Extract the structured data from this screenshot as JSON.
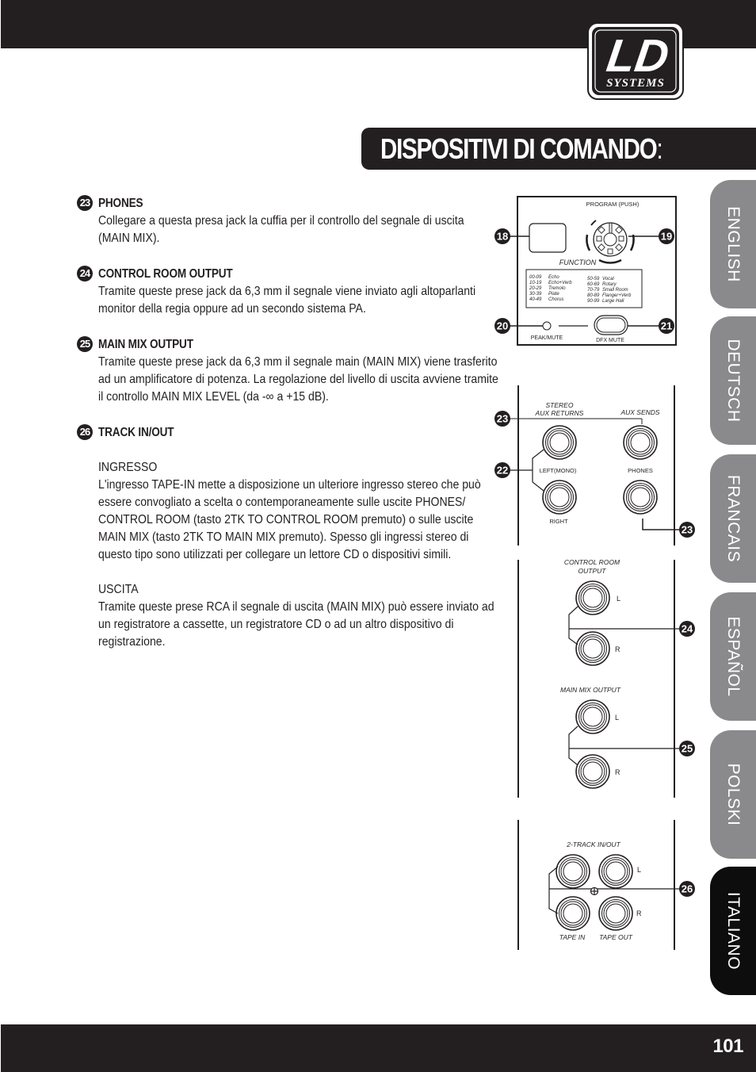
{
  "header": {
    "logo": {
      "brand": "LD",
      "sub": "SYSTEMS"
    }
  },
  "title": {
    "main": "DISPOSITIVI DI COMANDO",
    "suffix": ":"
  },
  "language_tabs": [
    {
      "label": "ENGLISH",
      "active": false
    },
    {
      "label": "DEUTSCH",
      "active": false
    },
    {
      "label": "FRANCAIS",
      "active": false
    },
    {
      "label": "ESPAÑOL",
      "active": false
    },
    {
      "label": "POLSKI",
      "active": false
    },
    {
      "label": "ITALIANO",
      "active": true
    }
  ],
  "sections": [
    {
      "number": "23",
      "title": "PHONES",
      "lines": [
        "Collegare a questa presa jack la cuffia per il controllo del segnale di uscita",
        "(MAIN MIX)."
      ]
    },
    {
      "number": "24",
      "title": "CONTROL ROOM OUTPUT",
      "lines": [
        "Tramite queste prese jack da 6,3 mm il segnale viene inviato agli altoparlanti",
        "monitor della regia oppure ad un secondo sistema PA."
      ]
    },
    {
      "number": "25",
      "title": "MAIN MIX OUTPUT",
      "lines": [
        "Tramite queste prese jack da 6,3 mm il segnale main (MAIN MIX) viene trasferito",
        "ad un amplificatore di potenza. La regolazione del livello di uscita avviene tramite",
        "il controllo MAIN MIX LEVEL (da -∞ a +15 dB)."
      ]
    },
    {
      "number": "26",
      "title": "TRACK IN/OUT",
      "subsections": [
        {
          "heading": "INGRESSO",
          "lines": [
            "L'ingresso TAPE-IN mette a disposizione un ulteriore ingresso stereo che può",
            "essere convogliato a scelta o contemporaneamente sulle uscite PHONES/",
            "CONTROL ROOM (tasto 2TK TO CONTROL ROOM premuto) o sulle uscite",
            "MAIN MIX (tasto 2TK TO MAIN MIX premuto). Spesso gli ingressi stereo di",
            "questo tipo sono utilizzati per collegare un lettore CD o dispositivi simili."
          ]
        },
        {
          "heading": "USCITA",
          "lines": [
            "Tramite queste prese RCA il segnale di uscita (MAIN MIX) può essere inviato ad",
            "un registratore a cassette, un registratore CD o ad un altro dispositivo di",
            "registrazione."
          ]
        }
      ]
    }
  ],
  "diagram": {
    "dfx_panel": {
      "program_label": "PROGRAM (PUSH)",
      "function_label": "FUNCTION",
      "presets_left": [
        {
          "range": "00-09",
          "name": "Echo"
        },
        {
          "range": "10-19",
          "name": "Echo+Verb"
        },
        {
          "range": "20-29",
          "name": "Tremolo"
        },
        {
          "range": "30-39",
          "name": "Plate"
        },
        {
          "range": "40-49",
          "name": "Chorus"
        }
      ],
      "presets_right": [
        {
          "range": "50-59",
          "name": "Vocal"
        },
        {
          "range": "60-69",
          "name": "Rotary"
        },
        {
          "range": "70-79",
          "name": "Small Room"
        },
        {
          "range": "80-89",
          "name": "Flanger+Verb"
        },
        {
          "range": "90-99",
          "name": "Large Hall"
        }
      ],
      "peak_mute_label": "PEAK/MUTE",
      "dfx_mute_label": "DFX MUTE",
      "callouts": [
        "18",
        "19",
        "20",
        "21"
      ]
    },
    "aux_panel": {
      "stereo_aux_returns": [
        "STEREO",
        "AUX RETURNS"
      ],
      "aux_sends": "AUX SENDS",
      "left_mono": "LEFT(MONO)",
      "right": "RIGHT",
      "phones": "PHONES",
      "callouts": [
        "23",
        "22",
        "23"
      ]
    },
    "output_panel": {
      "control_room": [
        "CONTROL ROOM",
        "OUTPUT"
      ],
      "main_mix": "MAIN MIX OUTPUT",
      "l": "L",
      "r": "R",
      "callouts": [
        "24",
        "25"
      ]
    },
    "tape_panel": {
      "title": "2-TRACK IN/OUT",
      "tape_in": "TAPE IN",
      "tape_out": "TAPE OUT",
      "l": "L",
      "r": "R",
      "callouts": [
        "26"
      ]
    }
  },
  "footer": {
    "page_number": "101"
  }
}
